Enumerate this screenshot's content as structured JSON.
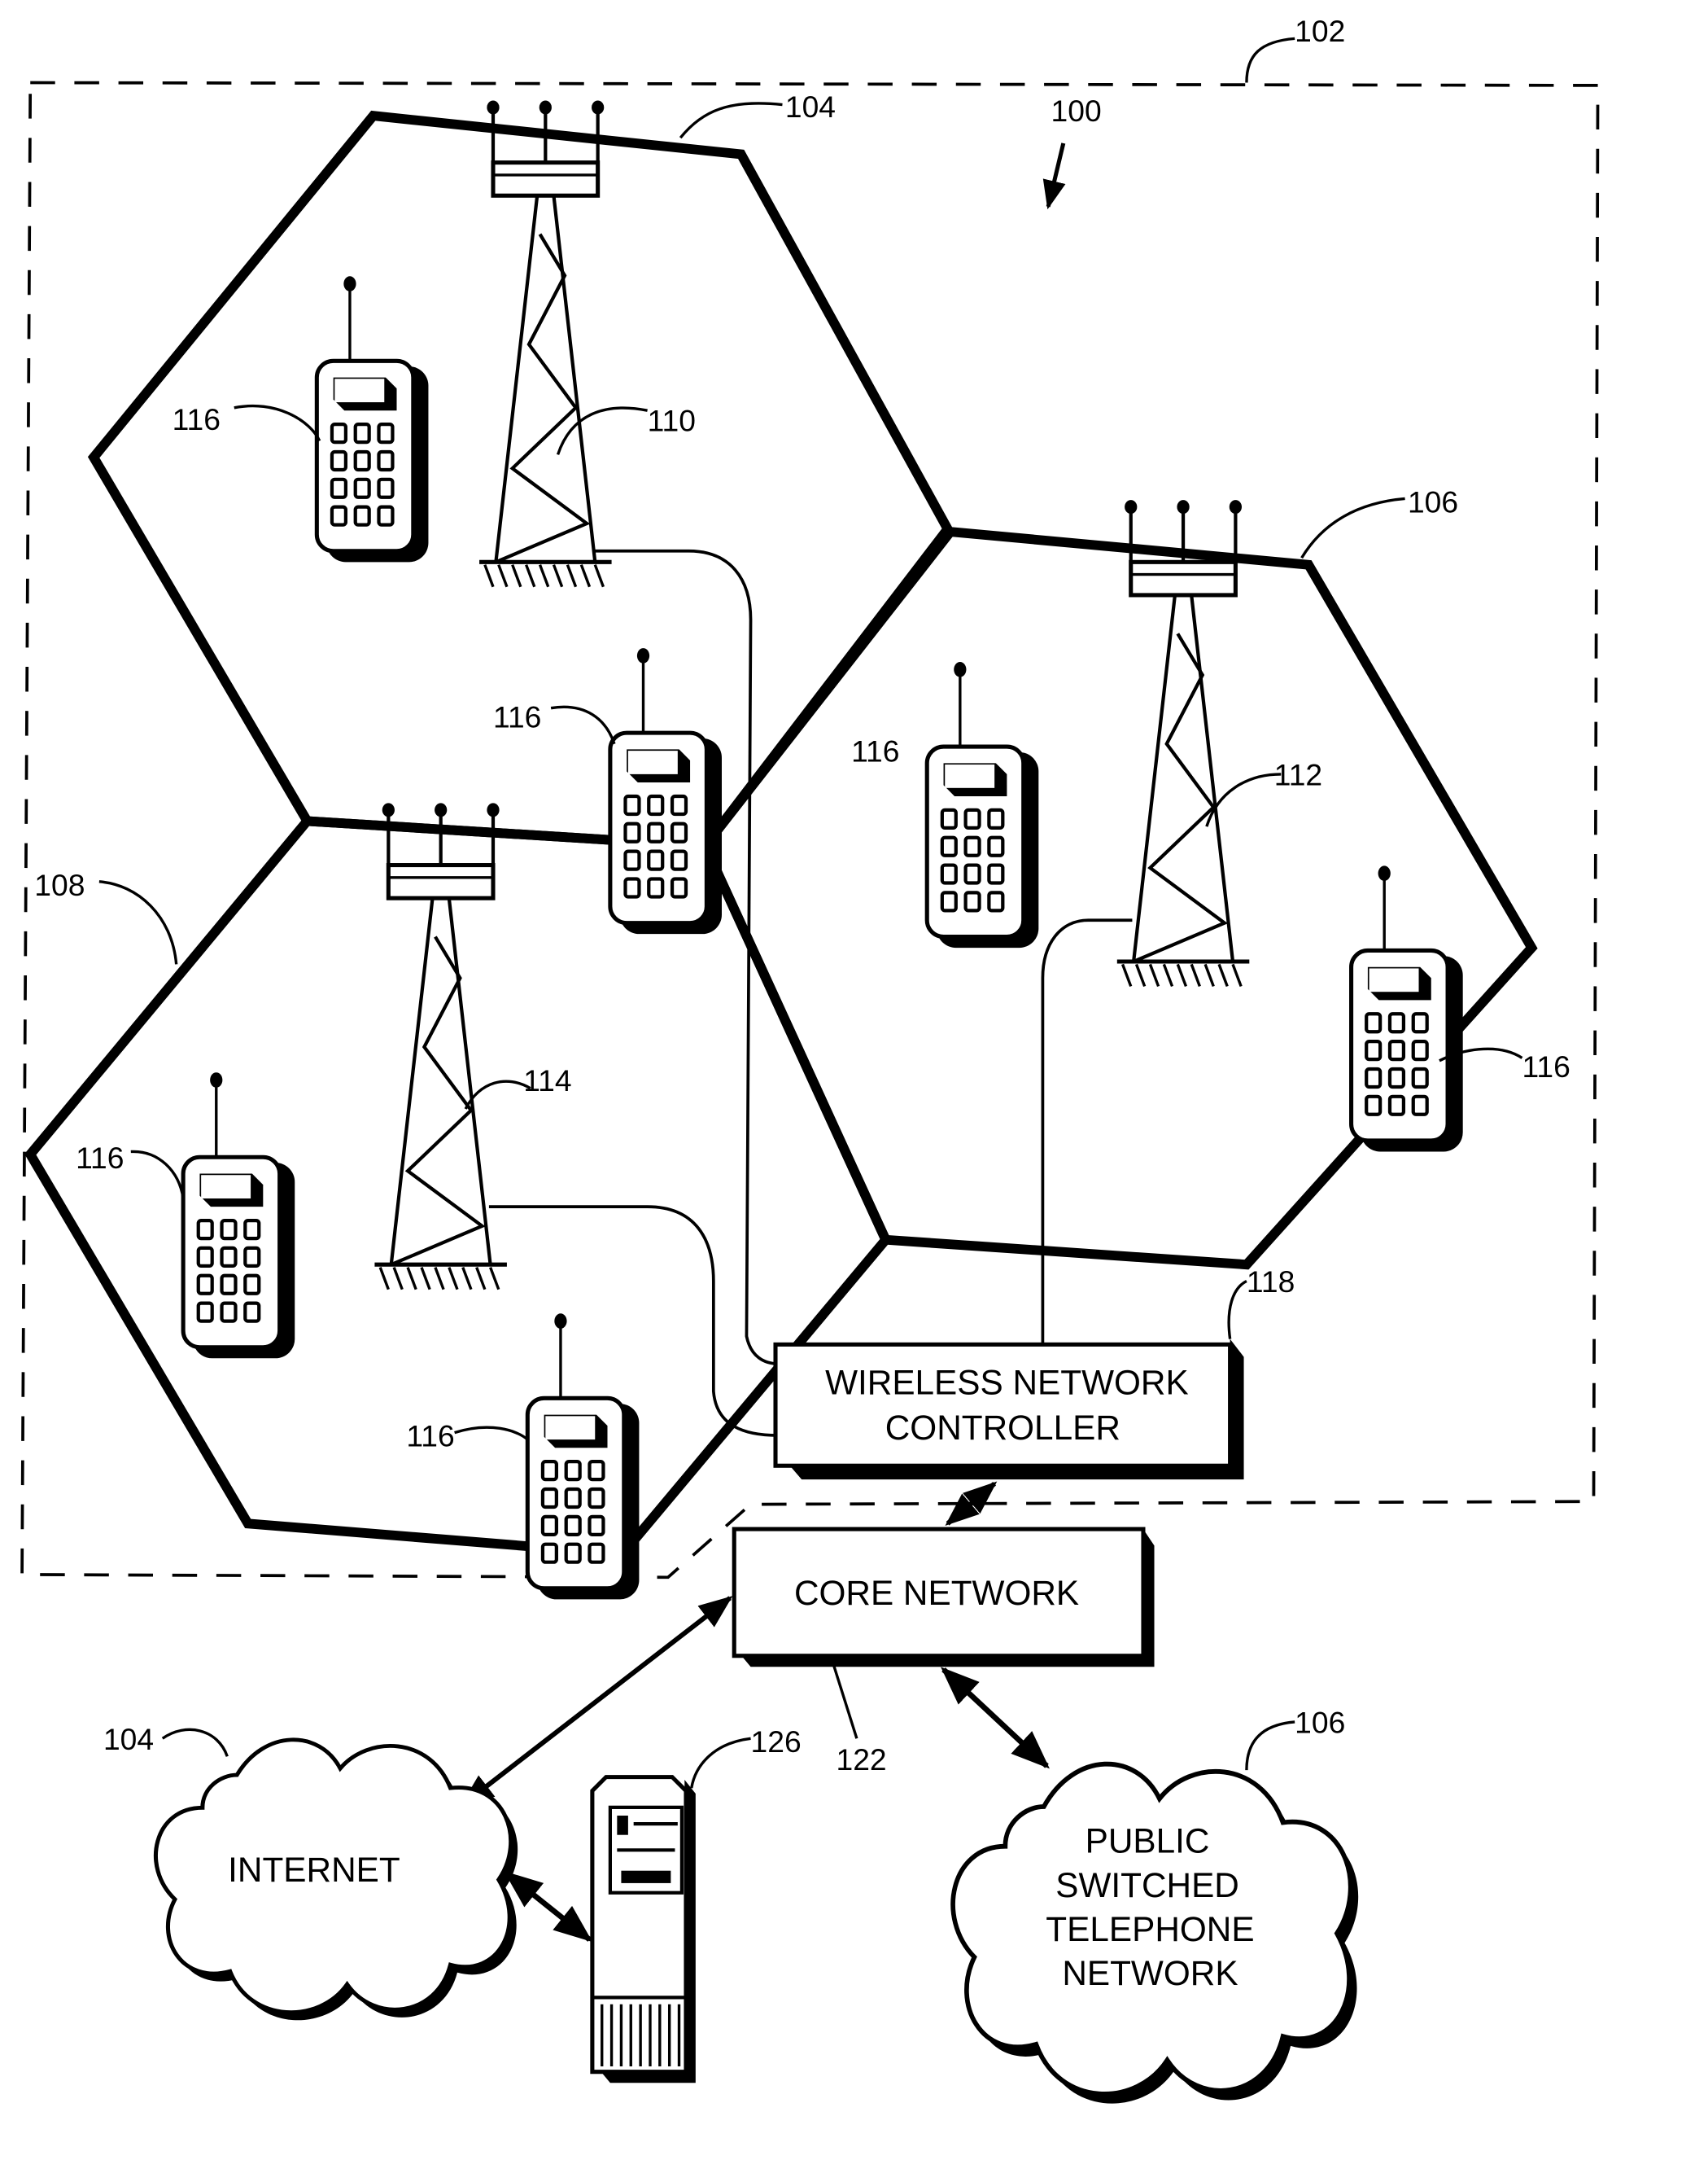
{
  "figure": {
    "system_ref": "100",
    "boundary_ref": "102",
    "colors": {
      "ink": "#000000",
      "paper": "#ffffff"
    }
  },
  "cells": [
    {
      "ref": "104",
      "name": "cell-104"
    },
    {
      "ref": "106",
      "name": "cell-106"
    },
    {
      "ref": "108",
      "name": "cell-108"
    }
  ],
  "towers": [
    {
      "ref": "110"
    },
    {
      "ref": "112"
    },
    {
      "ref": "114"
    }
  ],
  "mobile_ref": "116",
  "controller": {
    "ref": "118",
    "line1": "WIRELESS NETWORK",
    "line2": "CONTROLLER"
  },
  "core": {
    "ref": "122",
    "label": "CORE NETWORK"
  },
  "internet": {
    "ref": "104",
    "label": "INTERNET"
  },
  "pstn": {
    "ref": "106",
    "lines": [
      "PUBLIC",
      "SWITCHED",
      "TELEPHONE",
      "NETWORK"
    ]
  },
  "server": {
    "ref": "126"
  }
}
